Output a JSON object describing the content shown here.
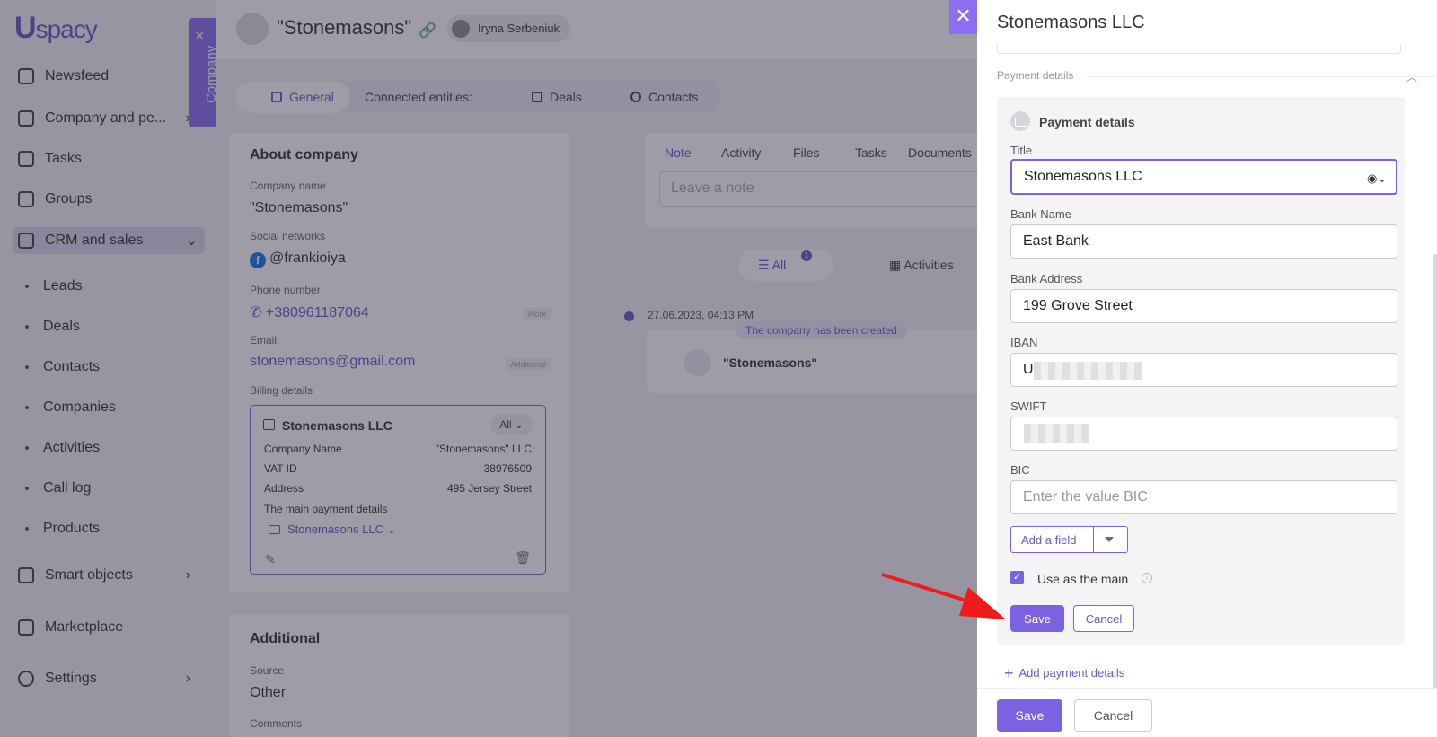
{
  "sidebar": {
    "logo": {
      "mark": "U",
      "text": "spacy"
    },
    "items": [
      {
        "label": "Newsfeed"
      },
      {
        "label": "Company and pe..."
      },
      {
        "label": "Tasks"
      },
      {
        "label": "Groups"
      },
      {
        "label": "CRM and sales"
      },
      {
        "label": "Smart objects"
      },
      {
        "label": "Marketplace"
      },
      {
        "label": "Settings"
      }
    ],
    "crm_subitems": [
      "Leads",
      "Deals",
      "Contacts",
      "Companies",
      "Activities",
      "Call log",
      "Products"
    ]
  },
  "company_tab": {
    "label": "Company",
    "close": "×"
  },
  "header": {
    "title": "\"Stonemasons\"",
    "user": "Iryna Serbeniuk"
  },
  "tabs": {
    "general": "General",
    "connected": "Connected entities:",
    "deals": "Deals",
    "contacts": "Contacts"
  },
  "about": {
    "title": "About company",
    "company_name_label": "Company name",
    "company_name": "\"Stonemasons\"",
    "social_label": "Social networks",
    "social_value": "@frankioiya",
    "phone_label": "Phone number",
    "phone": "+380961187064",
    "phone_tag": "Work",
    "email_label": "Email",
    "email": "stonemasons@gmail.com",
    "email_tag": "Additional",
    "billing_label": "Billing details",
    "billing": {
      "name": "Stonemasons LLC",
      "filter": "All",
      "rows": [
        {
          "label": "Company Name",
          "value": "\"Stonemasons\" LLC"
        },
        {
          "label": "VAT ID",
          "value": "38976509"
        },
        {
          "label": "Address",
          "value": "495 Jersey Street"
        }
      ],
      "main_payment_label": "The main payment details",
      "main_payment": "Stonemasons LLC"
    }
  },
  "additional": {
    "title": "Additional",
    "source_label": "Source",
    "source": "Other",
    "comments_label": "Comments"
  },
  "feed": {
    "tabs": [
      "Note",
      "Activity",
      "Files",
      "Tasks",
      "Documents"
    ],
    "note_placeholder": "Leave a note",
    "filter_all": "All",
    "filter_all_count": "1",
    "filter_activities": "Activities",
    "event_date": "27.06.2023, 04:13 PM",
    "event_badge": "The company has been created",
    "event_name": "\"Stonemasons\""
  },
  "panel": {
    "title": "Stonemasons LLC",
    "section_header": "Payment details",
    "box_title": "Payment details",
    "fields": {
      "title_label": "Title",
      "title_value": "Stonemasons LLC",
      "bank_name_label": "Bank Name",
      "bank_name_value": "East Bank",
      "bank_address_label": "Bank Address",
      "bank_address_value": "199 Grove Street",
      "iban_label": "IBAN",
      "iban_value": "U",
      "swift_label": "SWIFT",
      "bic_label": "BIC",
      "bic_placeholder": "Enter the value BIC"
    },
    "add_field": "Add a field",
    "use_as_main": "Use as the main",
    "save": "Save",
    "cancel": "Cancel",
    "add_payment_details": "Add payment details",
    "footer_save": "Save",
    "footer_cancel": "Cancel"
  },
  "colors": {
    "accent": "#7c62e0",
    "arrow": "#ee1c1c"
  }
}
